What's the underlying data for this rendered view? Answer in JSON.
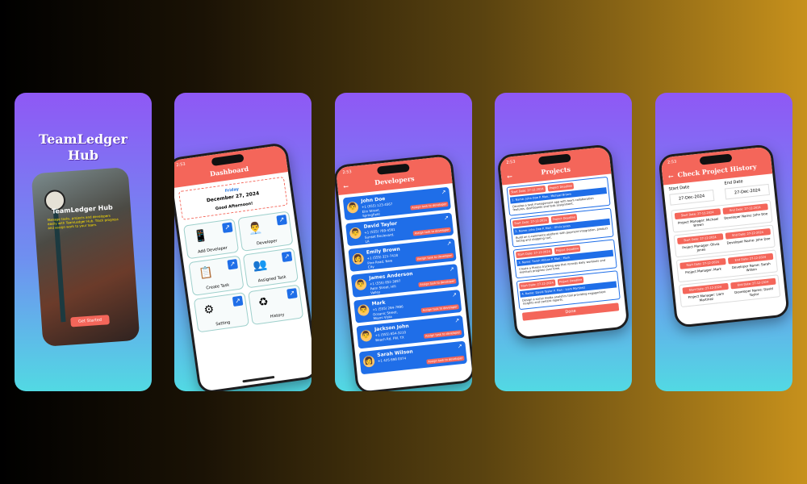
{
  "splash": {
    "title_line1": "TeamLedger",
    "title_line2": "Hub",
    "phone_title": "TeamLedger Hub",
    "description": "Manage tasks, projects and developers easily with TeamLedger Hub. Track progress and assign work to your team.",
    "button": "Get Started"
  },
  "dashboard": {
    "status_time": "2:53",
    "title": "Dashboard",
    "day": "Friday",
    "date": "December 27, 2024",
    "greeting": "Good Afternoon!",
    "tiles": [
      {
        "label": "Add Developer",
        "icon": "📱"
      },
      {
        "label": "Developer",
        "icon": "👨‍💼"
      },
      {
        "label": "Create Task",
        "icon": "📋"
      },
      {
        "label": "Assigned Task",
        "icon": "👥"
      },
      {
        "label": "Setting",
        "icon": "⚙"
      },
      {
        "label": "History",
        "icon": "♻"
      }
    ]
  },
  "developers": {
    "status_time": "2:53",
    "title": "Developers",
    "assign_label": "Assign task to developer",
    "items": [
      {
        "name": "John Doe",
        "phone": "+1 (555) 123-4567",
        "address": "Elm Street, Springfield",
        "avatar": "👨"
      },
      {
        "name": "David Taylor",
        "phone": "+1 (555) 789-4561",
        "address": "Sunset Boulevard, LA",
        "avatar": "👨"
      },
      {
        "name": "Emily Brown",
        "phone": "+1 (555) 321-7418",
        "address": "Pine Road, New City",
        "avatar": "👩"
      },
      {
        "name": "James Anderson",
        "phone": "+1 (555) 852-3697",
        "address": "Palm Street, Hill Valley",
        "avatar": "👨"
      },
      {
        "name": "Mark",
        "phone": "+1 (555) 284-7896",
        "address": "Oceanic Street, Miami Vista",
        "avatar": "👨"
      },
      {
        "name": "Jackson John",
        "phone": "+1 (555) 654-3210",
        "address": "Beach Rd, FW, TX",
        "avatar": "👨"
      },
      {
        "name": "Sarah Wilson",
        "phone": "+1 425 698 0374",
        "address": "",
        "avatar": "👩"
      }
    ]
  },
  "projects": {
    "status_time": "2:53",
    "title": "Projects",
    "done_button": "Done",
    "items": [
      {
        "tag1": "Start Date: 27-12-2024",
        "tag2": "Project Deadline",
        "line": "1. Name: John Doe  P. Man.: Michael Brown",
        "text": "Develop a task management app with team collaboration features, dashboards and task assignment."
      },
      {
        "tag1": "Start Date: 27-12-2024",
        "tag2": "Project Deadline",
        "line": "2. Name: John Doe  P. Man.: Olivia Jones",
        "text": "Build an e-commerce platform with payment integration, product listing and shopping cart."
      },
      {
        "tag1": "Start Date: 27-12-2024",
        "tag2": "Project Deadline",
        "line": "3. Name: Sarah Wilson  P. Man.: Mark",
        "text": "Create a fitness tracking app that records daily workouts and monitors progress over time."
      },
      {
        "tag1": "Start Date: 27-12-2024",
        "tag2": "Project Deadline",
        "line": "4. Name: David Taylor  P. Man.: Liam Martinez",
        "text": "Design a social media analytics tool providing engagement insights and content reports."
      }
    ]
  },
  "history": {
    "status_time": "2:53",
    "title": "Check Project History",
    "start_label": "Start Date",
    "end_label": "End Date",
    "start_value": "27-Dec-2024",
    "end_value": "27-Dec-2024",
    "items": [
      {
        "manager": "Project Manager: Michael Brown",
        "developer": "Developer Name: John Doe"
      },
      {
        "manager": "Project Manager: Olivia Jones",
        "developer": "Developer Name: John Doe"
      },
      {
        "manager": "Project Manager: Mark",
        "developer": "Developer Name: Sarah Wilson"
      },
      {
        "manager": "Project Manager: Liam Martinez",
        "developer": "Developer Name: David Taylor"
      }
    ],
    "tag_start": "Start Date: 27-12-2024",
    "tag_end": "End Date: 27-12-2024"
  }
}
